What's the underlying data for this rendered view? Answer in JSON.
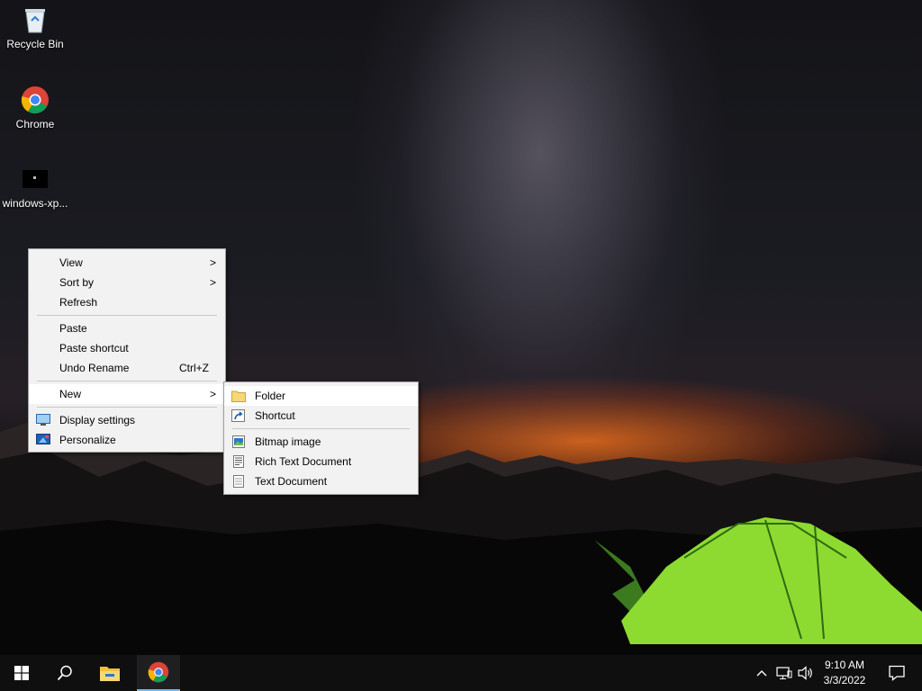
{
  "desktop": {
    "icons": [
      {
        "label": "Recycle Bin",
        "icon": "recycle-bin-icon"
      },
      {
        "label": "Chrome",
        "icon": "chrome-icon"
      },
      {
        "label": "windows-xp...",
        "icon": "image-file-icon"
      }
    ]
  },
  "context_menu": {
    "items": [
      {
        "label": "View",
        "submenu": true
      },
      {
        "label": "Sort by",
        "submenu": true
      },
      {
        "label": "Refresh"
      },
      {
        "label": "Paste"
      },
      {
        "label": "Paste shortcut"
      },
      {
        "label": "Undo Rename",
        "shortcut": "Ctrl+Z"
      },
      {
        "label": "New",
        "submenu": true,
        "highlighted": true
      },
      {
        "label": "Display settings",
        "icon": "display-settings-icon"
      },
      {
        "label": "Personalize",
        "icon": "personalize-icon"
      }
    ]
  },
  "new_submenu": {
    "items": [
      {
        "label": "Folder",
        "icon": "folder-icon",
        "highlighted": true
      },
      {
        "label": "Shortcut",
        "icon": "shortcut-icon"
      },
      {
        "label": "Bitmap image",
        "icon": "bitmap-icon"
      },
      {
        "label": "Rich Text Document",
        "icon": "rich-text-icon"
      },
      {
        "label": "Text Document",
        "icon": "text-document-icon"
      }
    ]
  },
  "taskbar": {
    "start_icon": "windows-logo-icon",
    "search_icon": "search-icon",
    "pinned": [
      {
        "name": "File Explorer",
        "icon": "file-explorer-icon"
      },
      {
        "name": "Chrome",
        "icon": "chrome-icon",
        "active": true
      }
    ],
    "tray_icons": [
      "chevron-up-icon",
      "network-icon",
      "volume-icon"
    ],
    "time": "9:10 AM",
    "date": "3/3/2022",
    "notification_icon": "notification-icon",
    "accent_color": "#76b9ed"
  }
}
